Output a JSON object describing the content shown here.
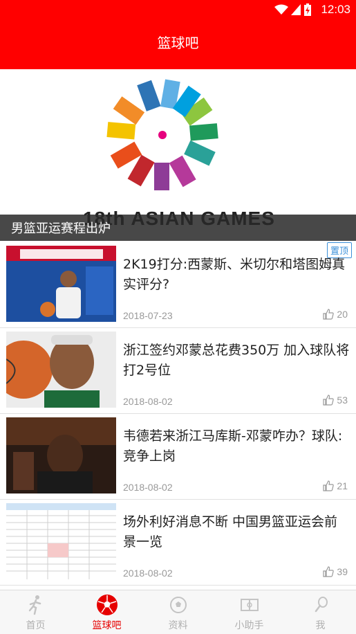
{
  "status_bar": {
    "time": "12:03"
  },
  "header": {
    "title": "篮球吧"
  },
  "banner": {
    "logo_text": "18th ASIAN GAMES",
    "caption": "男篮亚运赛程出炉"
  },
  "news": [
    {
      "title": "2K19打分:西蒙斯、米切尔和塔图姆真实评分?",
      "date": "2018-07-23",
      "likes": "20",
      "pinned": "置顶"
    },
    {
      "title": "浙江签约邓蒙总花费350万 加入球队将打2号位",
      "date": "2018-08-02",
      "likes": "53"
    },
    {
      "title": "韦德若来浙江马库斯-邓蒙咋办？球队:竞争上岗",
      "date": "2018-08-02",
      "likes": "21"
    },
    {
      "title": "场外利好消息不断 中国男篮亚运会前景一览",
      "date": "2018-08-02",
      "likes": "39"
    }
  ],
  "tabs": [
    {
      "label": "首页",
      "icon": "runner-icon"
    },
    {
      "label": "篮球吧",
      "icon": "ball-icon"
    },
    {
      "label": "资料",
      "icon": "soccer-icon"
    },
    {
      "label": "小助手",
      "icon": "court-icon"
    },
    {
      "label": "我",
      "icon": "tennis-icon"
    }
  ],
  "colors": {
    "brand": "#ff0000",
    "active_tab": "#e60000",
    "pin": "#3a8fd9"
  }
}
